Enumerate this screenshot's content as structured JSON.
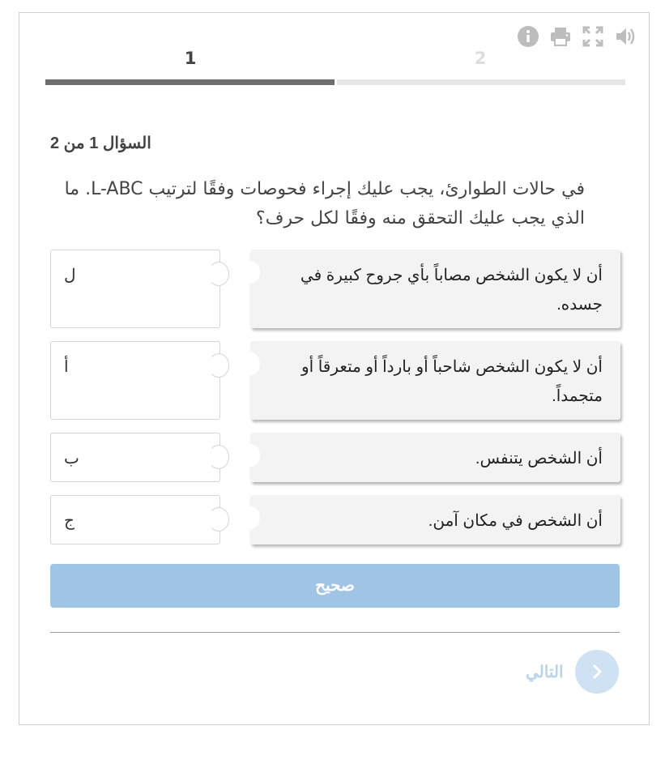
{
  "toolbar": {
    "icons": [
      "info-icon",
      "print-icon",
      "fullscreen-icon",
      "speaker-icon"
    ],
    "icon_color": "#bdbdbd"
  },
  "tabs": [
    {
      "label": "1",
      "active": true
    },
    {
      "label": "2",
      "active": false
    }
  ],
  "question": {
    "counter": "السؤال 1 من 2",
    "text": "في حالات الطوارئ، يجب عليك إجراء فحوصات وفقًا لترتيب L-ABC. ما الذي يجب عليك التحقق منه وفقًا لكل حرف؟"
  },
  "pairs": [
    {
      "letter": "ل",
      "answer": "أن لا يكون الشخص مصاباً بأي جروح كبيرة في جسده."
    },
    {
      "letter": "أ",
      "answer": "أن لا يكون الشخص شاحباً أو بارداً أو متعرقاً أو متجمداً."
    },
    {
      "letter": "ب",
      "answer": "أن الشخص يتنفس."
    },
    {
      "letter": "ج",
      "answer": "أن الشخص في مكان آمن."
    }
  ],
  "check_button": "صحيح",
  "next_button": "التالي",
  "colors": {
    "accent_disabled": "#9fc4e6",
    "progress_active": "#6d6d6d",
    "progress_inactive": "#e6e6e6"
  }
}
